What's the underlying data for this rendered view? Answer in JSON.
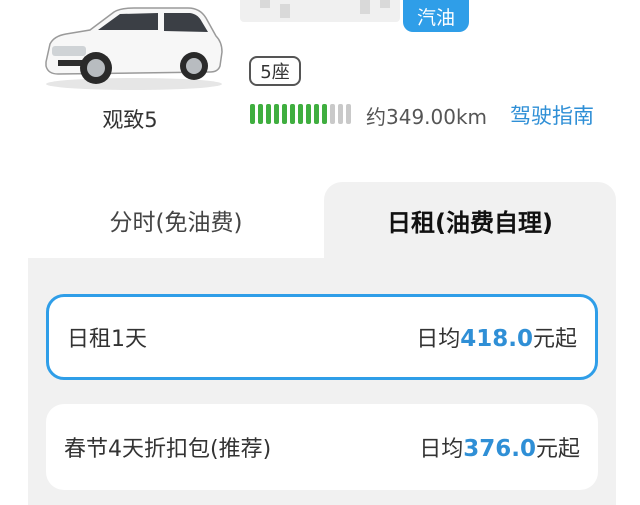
{
  "car": {
    "name": "观致5",
    "fuel_tag": "汽油",
    "seats": "5座",
    "range": "约349.00km",
    "guide_link": "驾驶指南",
    "battery_level": 0.8
  },
  "tabs": [
    {
      "label": "分时(免油费)",
      "active": false
    },
    {
      "label": "日租(油费自理)",
      "active": true
    }
  ],
  "packages": [
    {
      "name": "日租1天",
      "prefix": "日均",
      "price": "418.0",
      "suffix": "元起",
      "selected": true
    },
    {
      "name": "春节4天折扣包(推荐)",
      "prefix": "日均",
      "price": "376.0",
      "suffix": "元起",
      "selected": false
    }
  ],
  "colors": {
    "accent": "#2f9ee8",
    "battery_on": "#3fae3f",
    "battery_off": "#c9c9c9"
  }
}
